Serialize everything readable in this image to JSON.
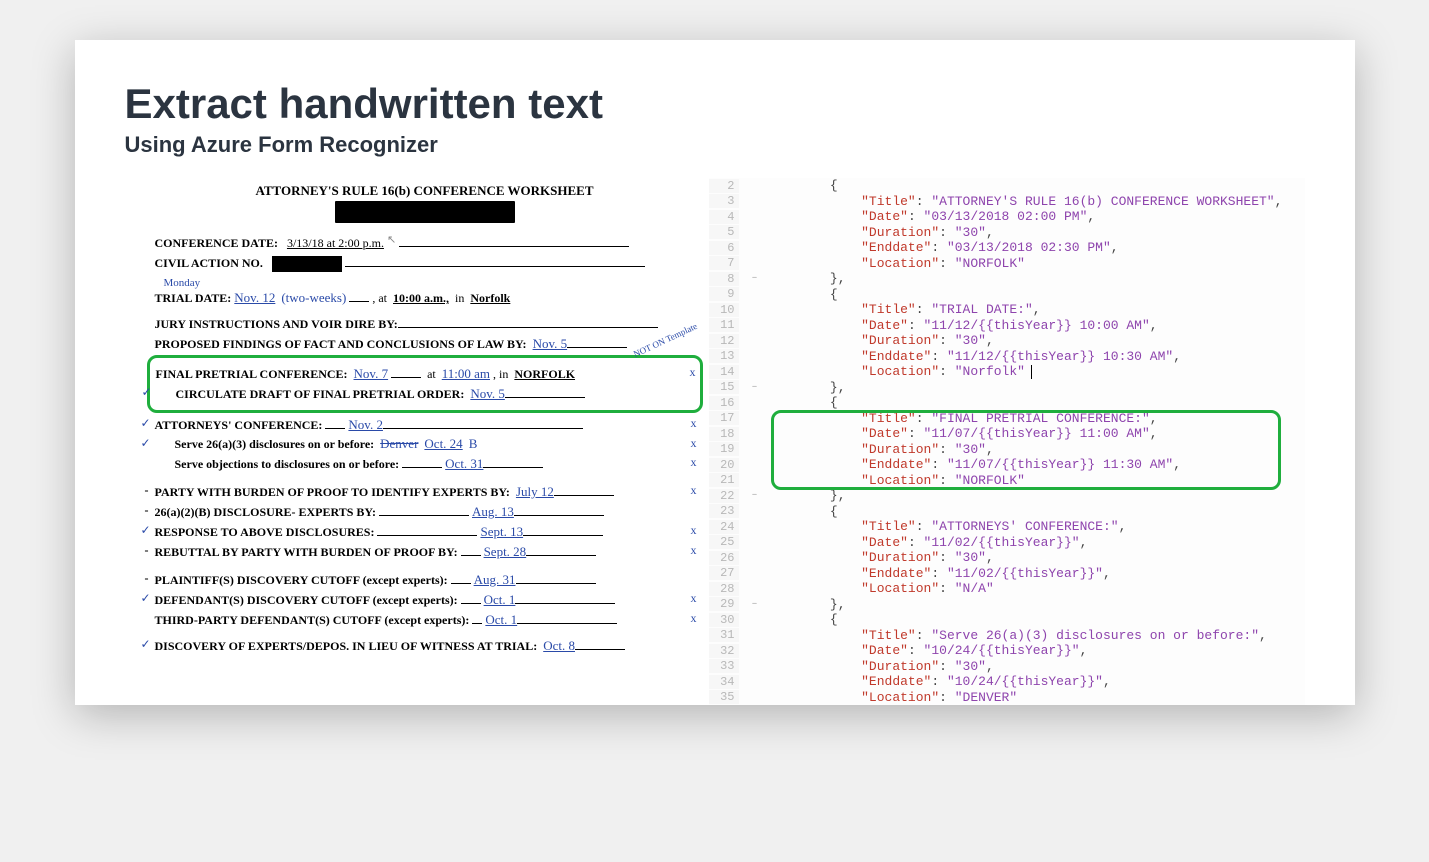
{
  "header": {
    "title": "Extract handwritten text",
    "subtitle": "Using Azure Form Recognizer"
  },
  "form": {
    "title": "ATTORNEY'S RULE 16(b) CONFERENCE WORKSHEET",
    "conf_date_label": "CONFERENCE DATE:",
    "conf_date_value": "3/13/18 at 2:00 p.m.",
    "civil_label": "CIVIL ACTION NO.",
    "monday_note": "Monday",
    "trial_label": "TRIAL DATE:",
    "trial_date": "Nov. 12",
    "two_weeks": "(two-weeks)",
    "at_label": ", at",
    "trial_time": "10:00 a.m.,",
    "in_label": "in",
    "trial_loc": "Norfolk",
    "jury_label": "JURY INSTRUCTIONS AND VOIR DIRE BY:",
    "prop_label": "PROPOSED FINDINGS OF FACT AND CONCLUSIONS OF LAW BY:",
    "prop_value": "Nov. 5",
    "margin_note": "NOT ON\nTemplate",
    "final_label": "FINAL PRETRIAL CONFERENCE:",
    "final_date": "Nov. 7",
    "final_at": "at",
    "final_time": "11:00 am",
    "final_in": ", in",
    "final_loc": "NORFOLK",
    "circ_label": "CIRCULATE DRAFT OF FINAL PRETRIAL ORDER:",
    "circ_value": "Nov. 5",
    "att_conf_label": "ATTORNEYS' CONFERENCE:",
    "att_conf_value": "Nov. 2",
    "serve_a_label": "Serve 26(a)(3) disclosures on or before:",
    "serve_a_strike": "Denver",
    "serve_a_value": "Oct. 24",
    "serve_b_label": "Serve objections to disclosures on or before:",
    "serve_b_value": "Oct. 31",
    "party_label": "PARTY WITH BURDEN OF PROOF TO IDENTIFY EXPERTS BY:",
    "party_value": "July 12",
    "disc_b_label": "26(a)(2)(B)  DISCLOSURE- EXPERTS BY:",
    "disc_b_value": "Aug. 13",
    "resp_label": "RESPONSE TO ABOVE DISCLOSURES:",
    "resp_value": "Sept. 13",
    "rebut_label": "REBUTTAL BY PARTY WITH BURDEN OF PROOF BY:",
    "rebut_value": "Sept. 28",
    "plaint_label": "PLAINTIFF(S) DISCOVERY CUTOFF (except experts):",
    "plaint_value": "Aug. 31",
    "def_label": "DEFENDANT(S) DISCOVERY CUTOFF (except experts):",
    "def_value": "Oct. 1",
    "third_label": "THIRD-PARTY DEFENDANT(S) CUTOFF (except experts):",
    "third_value": "Oct. 1",
    "depo_label": "DISCOVERY OF EXPERTS/DEPOS. IN LIEU OF WITNESS AT TRIAL:",
    "depo_value": "Oct. 8",
    "x": "x",
    "b_mark": "B"
  },
  "code": {
    "lines": [
      {
        "n": "2",
        "fold": "",
        "txt": [
          {
            "p": "        {"
          }
        ]
      },
      {
        "n": "3",
        "txt": [
          {
            "p": "            "
          },
          {
            "k": "\"Title\""
          },
          {
            "p": ": "
          },
          {
            "s": "\"ATTORNEY'S RULE 16(b) CONFERENCE WORKSHEET\""
          },
          {
            "p": ","
          }
        ]
      },
      {
        "n": "4",
        "txt": [
          {
            "p": "            "
          },
          {
            "k": "\"Date\""
          },
          {
            "p": ": "
          },
          {
            "s": "\"03/13/2018 02:00 PM\""
          },
          {
            "p": ","
          }
        ]
      },
      {
        "n": "5",
        "txt": [
          {
            "p": "            "
          },
          {
            "k": "\"Duration\""
          },
          {
            "p": ": "
          },
          {
            "s": "\"30\""
          },
          {
            "p": ","
          }
        ]
      },
      {
        "n": "6",
        "txt": [
          {
            "p": "            "
          },
          {
            "k": "\"Enddate\""
          },
          {
            "p": ": "
          },
          {
            "s": "\"03/13/2018 02:30 PM\""
          },
          {
            "p": ","
          }
        ]
      },
      {
        "n": "7",
        "txt": [
          {
            "p": "            "
          },
          {
            "k": "\"Location\""
          },
          {
            "p": ": "
          },
          {
            "s": "\"NORFOLK\""
          }
        ]
      },
      {
        "n": "8",
        "fold": "–",
        "txt": [
          {
            "p": "        },"
          }
        ]
      },
      {
        "n": "9",
        "fold": "",
        "txt": [
          {
            "p": "        {"
          }
        ]
      },
      {
        "n": "10",
        "txt": [
          {
            "p": "            "
          },
          {
            "k": "\"Title\""
          },
          {
            "p": ": "
          },
          {
            "s": "\"TRIAL DATE:\""
          },
          {
            "p": ","
          }
        ]
      },
      {
        "n": "11",
        "txt": [
          {
            "p": "            "
          },
          {
            "k": "\"Date\""
          },
          {
            "p": ": "
          },
          {
            "s": "\"11/12/{{thisYear}} 10:00 AM\""
          },
          {
            "p": ","
          }
        ]
      },
      {
        "n": "12",
        "txt": [
          {
            "p": "            "
          },
          {
            "k": "\"Duration\""
          },
          {
            "p": ": "
          },
          {
            "s": "\"30\""
          },
          {
            "p": ","
          }
        ]
      },
      {
        "n": "13",
        "txt": [
          {
            "p": "            "
          },
          {
            "k": "\"Enddate\""
          },
          {
            "p": ": "
          },
          {
            "s": "\"11/12/{{thisYear}} 10:30 AM\""
          },
          {
            "p": ","
          }
        ]
      },
      {
        "n": "14",
        "txt": [
          {
            "p": "            "
          },
          {
            "k": "\"Location\""
          },
          {
            "p": ": "
          },
          {
            "s": "\"Norfolk\""
          },
          {
            "cur": true
          }
        ]
      },
      {
        "n": "15",
        "fold": "–",
        "txt": [
          {
            "p": "        },"
          }
        ]
      },
      {
        "n": "16",
        "fold": "",
        "txt": [
          {
            "p": "        {"
          }
        ]
      },
      {
        "n": "17",
        "txt": [
          {
            "p": "            "
          },
          {
            "k": "\"Title\""
          },
          {
            "p": ": "
          },
          {
            "s": "\"FINAL PRETRIAL CONFERENCE:\""
          },
          {
            "p": ","
          }
        ]
      },
      {
        "n": "18",
        "txt": [
          {
            "p": "            "
          },
          {
            "k": "\"Date\""
          },
          {
            "p": ": "
          },
          {
            "s": "\"11/07/{{thisYear}} 11:00 AM\""
          },
          {
            "p": ","
          }
        ]
      },
      {
        "n": "19",
        "txt": [
          {
            "p": "            "
          },
          {
            "k": "\"Duration\""
          },
          {
            "p": ": "
          },
          {
            "s": "\"30\""
          },
          {
            "p": ","
          }
        ]
      },
      {
        "n": "20",
        "txt": [
          {
            "p": "            "
          },
          {
            "k": "\"Enddate\""
          },
          {
            "p": ": "
          },
          {
            "s": "\"11/07/{{thisYear}} 11:30 AM\""
          },
          {
            "p": ","
          }
        ]
      },
      {
        "n": "21",
        "txt": [
          {
            "p": "            "
          },
          {
            "k": "\"Location\""
          },
          {
            "p": ": "
          },
          {
            "s": "\"NORFOLK\""
          }
        ]
      },
      {
        "n": "22",
        "fold": "–",
        "txt": [
          {
            "p": "        },"
          }
        ]
      },
      {
        "n": "23",
        "fold": "",
        "txt": [
          {
            "p": "        {"
          }
        ]
      },
      {
        "n": "24",
        "txt": [
          {
            "p": "            "
          },
          {
            "k": "\"Title\""
          },
          {
            "p": ": "
          },
          {
            "s": "\"ATTORNEYS' CONFERENCE:\""
          },
          {
            "p": ","
          }
        ]
      },
      {
        "n": "25",
        "txt": [
          {
            "p": "            "
          },
          {
            "k": "\"Date\""
          },
          {
            "p": ": "
          },
          {
            "s": "\"11/02/{{thisYear}}\""
          },
          {
            "p": ","
          }
        ]
      },
      {
        "n": "26",
        "txt": [
          {
            "p": "            "
          },
          {
            "k": "\"Duration\""
          },
          {
            "p": ": "
          },
          {
            "s": "\"30\""
          },
          {
            "p": ","
          }
        ]
      },
      {
        "n": "27",
        "txt": [
          {
            "p": "            "
          },
          {
            "k": "\"Enddate\""
          },
          {
            "p": ": "
          },
          {
            "s": "\"11/02/{{thisYear}}\""
          },
          {
            "p": ","
          }
        ]
      },
      {
        "n": "28",
        "txt": [
          {
            "p": "            "
          },
          {
            "k": "\"Location\""
          },
          {
            "p": ": "
          },
          {
            "s": "\"N/A\""
          }
        ]
      },
      {
        "n": "29",
        "fold": "–",
        "txt": [
          {
            "p": "        },"
          }
        ]
      },
      {
        "n": "30",
        "fold": "",
        "txt": [
          {
            "p": "        {"
          }
        ]
      },
      {
        "n": "31",
        "txt": [
          {
            "p": "            "
          },
          {
            "k": "\"Title\""
          },
          {
            "p": ": "
          },
          {
            "s": "\"Serve 26(a)(3) disclosures on or before:\""
          },
          {
            "p": ","
          }
        ]
      },
      {
        "n": "32",
        "txt": [
          {
            "p": "            "
          },
          {
            "k": "\"Date\""
          },
          {
            "p": ": "
          },
          {
            "s": "\"10/24/{{thisYear}}\""
          },
          {
            "p": ","
          }
        ]
      },
      {
        "n": "33",
        "txt": [
          {
            "p": "            "
          },
          {
            "k": "\"Duration\""
          },
          {
            "p": ": "
          },
          {
            "s": "\"30\""
          },
          {
            "p": ","
          }
        ]
      },
      {
        "n": "34",
        "txt": [
          {
            "p": "            "
          },
          {
            "k": "\"Enddate\""
          },
          {
            "p": ": "
          },
          {
            "s": "\"10/24/{{thisYear}}\""
          },
          {
            "p": ","
          }
        ]
      },
      {
        "n": "35",
        "txt": [
          {
            "p": "            "
          },
          {
            "k": "\"Location\""
          },
          {
            "p": ": "
          },
          {
            "s": "\"DENVER\""
          }
        ]
      }
    ]
  }
}
